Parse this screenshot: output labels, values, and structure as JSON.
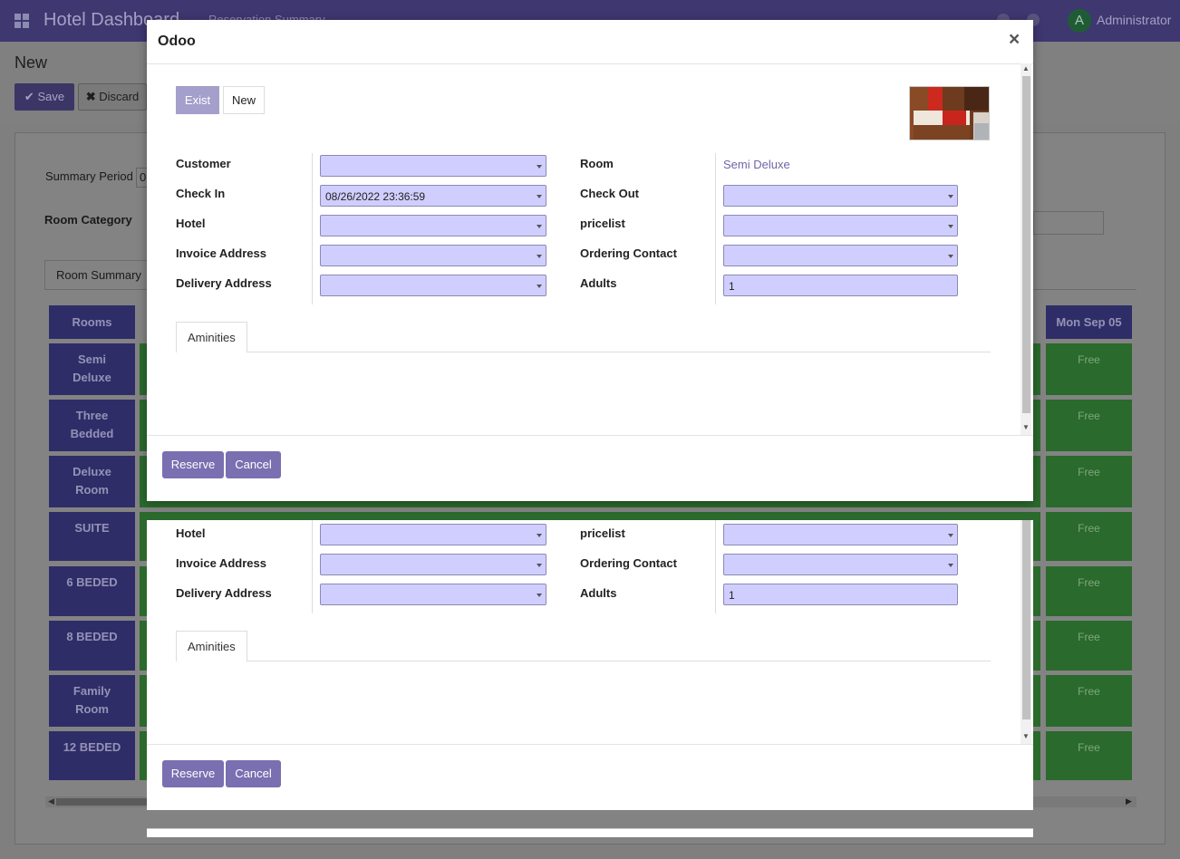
{
  "navbar": {
    "app_title": "Hotel Dashboard",
    "menu_item": "Reservation Summary",
    "user": "Administrator",
    "avatar_letter": "A",
    "avatar_color": "#2e7d32"
  },
  "control_panel": {
    "breadcrumb": "New",
    "save_label": "Save",
    "discard_label": "Discard"
  },
  "background": {
    "summary_period_label": "Summary Period",
    "summary_period_value": "0",
    "room_category_label": "Room Category",
    "tab_label": "Room Summary",
    "grid": {
      "rooms_header": "Rooms",
      "last_date_header": "Mon Sep 05",
      "rooms": [
        {
          "name": "Semi Deluxe",
          "status": "Free"
        },
        {
          "name": "Three Bedded",
          "status": "Free"
        },
        {
          "name": "Deluxe Room",
          "status": "Free"
        },
        {
          "name": "SUITE",
          "status": "Free"
        },
        {
          "name": "6 BEDED",
          "status": "Free"
        },
        {
          "name": "8 BEDED",
          "status": "Free"
        },
        {
          "name": "Family Room",
          "status": "Free"
        },
        {
          "name": "12 BEDED",
          "status": "Free"
        }
      ]
    }
  },
  "dialog": {
    "title": "Odoo",
    "close_symbol": "×",
    "toggle": {
      "exist": "Exist",
      "new": "New"
    },
    "fields_left": [
      {
        "label": "Customer",
        "value": ""
      },
      {
        "label": "Check In",
        "value": "08/26/2022 23:36:59"
      },
      {
        "label": "Hotel",
        "value": ""
      },
      {
        "label": "Invoice Address",
        "value": ""
      },
      {
        "label": "Delivery Address",
        "value": ""
      }
    ],
    "fields_right": [
      {
        "label": "Room",
        "value": "Semi Deluxe"
      },
      {
        "label": "Check Out",
        "value": ""
      },
      {
        "label": "pricelist",
        "value": ""
      },
      {
        "label": "Ordering Contact",
        "value": ""
      },
      {
        "label": "Adults",
        "value": "1"
      }
    ],
    "tab_label": "Aminities",
    "reserve_label": "Reserve",
    "cancel_label": "Cancel"
  },
  "colors": {
    "primary": "#7c6fb0",
    "select_bg": "#d0cefe",
    "room_link": "#6f66a6",
    "free_cell": "#2e7d32",
    "room_header": "#312e72"
  }
}
